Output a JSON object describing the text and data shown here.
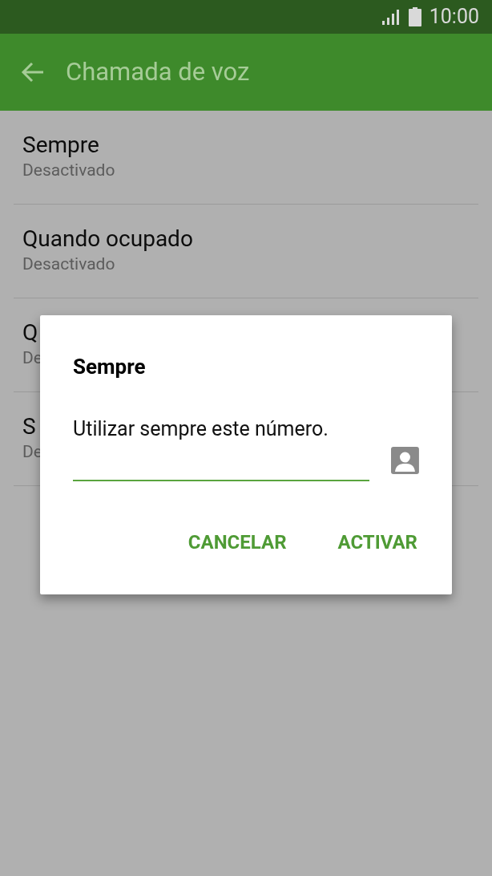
{
  "status_bar": {
    "time": "10:00"
  },
  "app_bar": {
    "title": "Chamada de voz"
  },
  "settings": [
    {
      "title": "Sempre",
      "subtitle": "Desactivado"
    },
    {
      "title": "Quando ocupado",
      "subtitle": "Desactivado"
    },
    {
      "title": "Q",
      "subtitle": "De"
    },
    {
      "title": "S",
      "subtitle": "De"
    }
  ],
  "dialog": {
    "title": "Sempre",
    "message": "Utilizar sempre este número.",
    "buttons": [
      "CANCELAR",
      "ACTIVAR"
    ]
  }
}
